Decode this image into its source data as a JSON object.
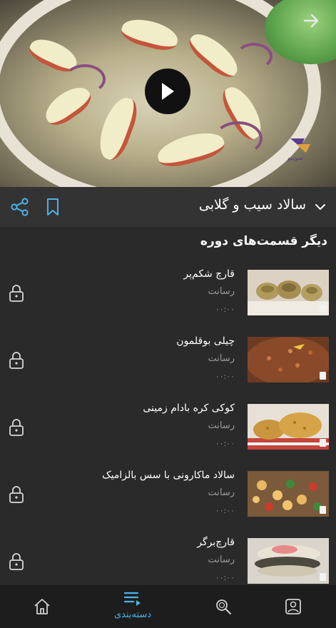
{
  "video": {
    "logo_text": "سوینو",
    "logo_subtext": "SOOUINO"
  },
  "title_bar": {
    "title": "سالاد سیب و گلابی"
  },
  "episodes_heading": "دیگر قسمت‌های دوره",
  "episodes": [
    {
      "title": "قارچ شکم‌پر",
      "source": "رسانت",
      "duration": "۰۰:۰۰",
      "thumb": "stuffed-mushrooms"
    },
    {
      "title": "چیلی بوقلمون",
      "source": "رسانت",
      "duration": "۰۰:۰۰",
      "thumb": "turkey-chili"
    },
    {
      "title": "کوکی کره بادام زمینی",
      "source": "رسانت",
      "duration": "۰۰:۰۰",
      "thumb": "peanut-cookies"
    },
    {
      "title": "سالاد ماکارونی با سس بالزامیک",
      "source": "رسانت",
      "duration": "۰۰:۰۰",
      "thumb": "pasta-salad"
    },
    {
      "title": "قارچ‌برگر",
      "source": "رسانت",
      "duration": "۰۰:۰۰",
      "thumb": "mushroom-burger"
    }
  ],
  "nav": {
    "category_label": "دسته‌بندی"
  },
  "colors": {
    "accent": "#4ab3e8",
    "background": "#2a2a2a",
    "title_bar": "#333333",
    "nav_bar": "#1d1d1d"
  }
}
